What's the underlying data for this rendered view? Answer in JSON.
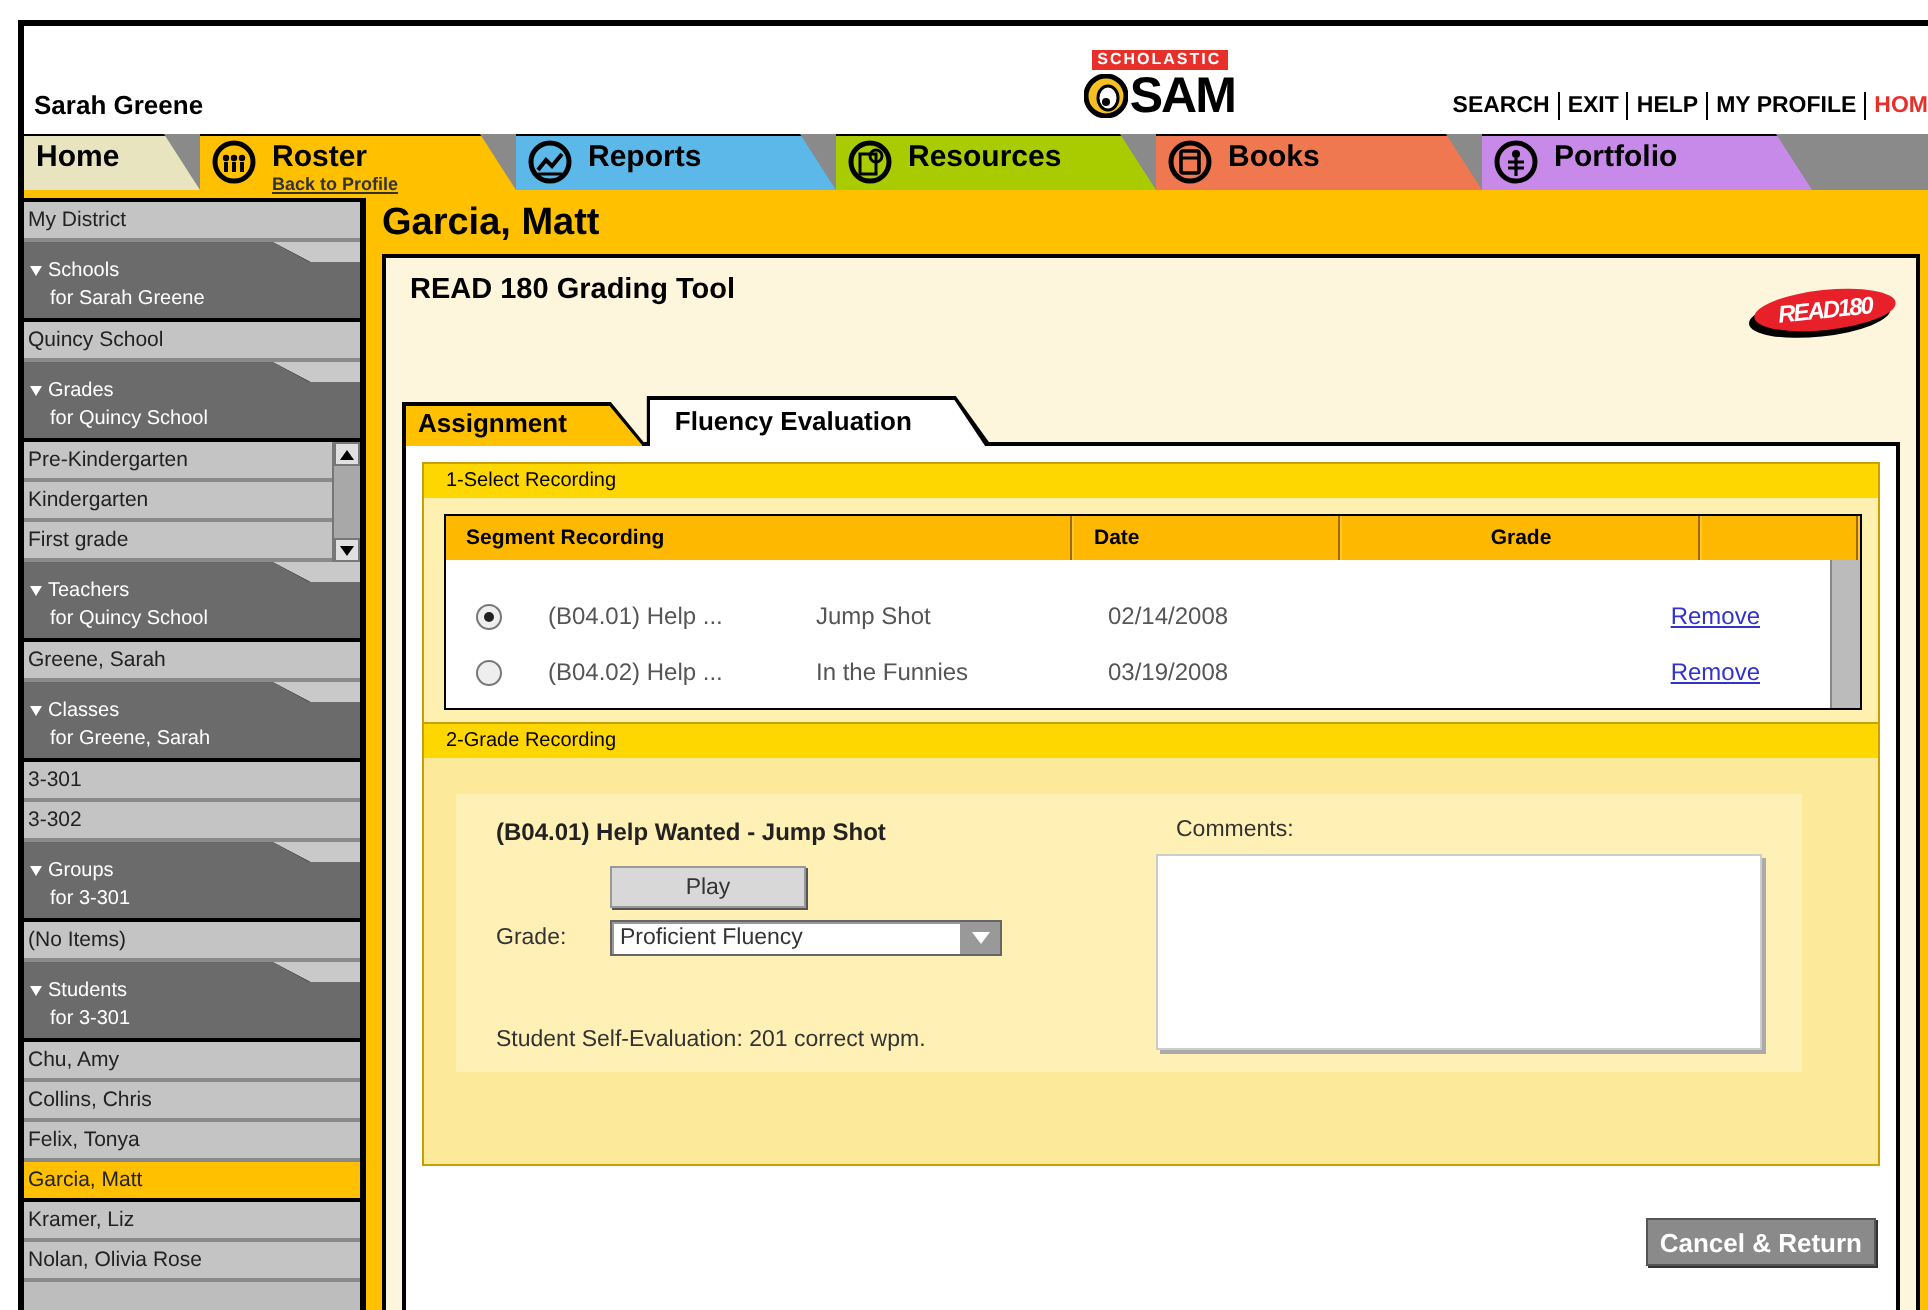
{
  "header": {
    "user_name": "Sarah Greene",
    "brand": "SCHOLASTIC",
    "logo": "SAM",
    "links": [
      {
        "label": "SEARCH",
        "kind": "plain"
      },
      {
        "label": "EXIT",
        "kind": "plain"
      },
      {
        "label": "HELP",
        "kind": "plain"
      },
      {
        "label": "MY PROFILE",
        "kind": "plain"
      },
      {
        "label": "HOM",
        "kind": "alert"
      }
    ]
  },
  "nav_tabs": [
    {
      "label": "Home",
      "selected": false,
      "color": "#e8e4c0"
    },
    {
      "label": "Roster",
      "sublink": "Back to Profile",
      "selected": true,
      "color": "#ffc000"
    },
    {
      "label": "Reports",
      "selected": false,
      "color": "#5bb8e8"
    },
    {
      "label": "Resources",
      "selected": false,
      "color": "#a8cc00"
    },
    {
      "label": "Books",
      "selected": false,
      "color": "#f07850"
    },
    {
      "label": "Portfolio",
      "selected": false,
      "color": "#c88ae8"
    }
  ],
  "sidebar": [
    {
      "kind": "link",
      "label": "My District",
      "selected": false
    },
    {
      "kind": "header",
      "title": "Schools",
      "subtitle": "for Sarah Greene"
    },
    {
      "kind": "link",
      "label": "Quincy School",
      "selected": false
    },
    {
      "kind": "header",
      "title": "Grades",
      "subtitle": "for Quincy School"
    },
    {
      "kind": "scroll_list",
      "items": [
        {
          "label": "Pre-Kindergarten",
          "selected": false
        },
        {
          "label": "Kindergarten",
          "selected": false
        },
        {
          "label": "First grade",
          "selected": false
        }
      ]
    },
    {
      "kind": "header",
      "title": "Teachers",
      "subtitle": "for Quincy School"
    },
    {
      "kind": "link",
      "label": "Greene, Sarah",
      "selected": false
    },
    {
      "kind": "header",
      "title": "Classes",
      "subtitle": "for Greene, Sarah"
    },
    {
      "kind": "link",
      "label": "3-301",
      "selected": false
    },
    {
      "kind": "link",
      "label": "3-302",
      "selected": false
    },
    {
      "kind": "header",
      "title": "Groups",
      "subtitle": "for 3-301"
    },
    {
      "kind": "link",
      "label": "(No Items)",
      "selected": false
    },
    {
      "kind": "header",
      "title": "Students",
      "subtitle": "for 3-301"
    },
    {
      "kind": "link",
      "label": "Chu, Amy",
      "selected": false
    },
    {
      "kind": "link",
      "label": "Collins, Chris",
      "selected": false
    },
    {
      "kind": "link",
      "label": "Felix, Tonya",
      "selected": false
    },
    {
      "kind": "link",
      "label": "Garcia, Matt",
      "selected": true
    },
    {
      "kind": "link",
      "label": "Kramer, Liz",
      "selected": false
    },
    {
      "kind": "link",
      "label": "Nolan, Olivia Rose",
      "selected": false
    }
  ],
  "main": {
    "student": "Garcia, Matt",
    "tool_title": "READ 180 Grading Tool",
    "product_logo": "READ180",
    "tabs": [
      {
        "label": "Assignment",
        "selected": false
      },
      {
        "label": "Fluency Evaluation",
        "selected": true
      }
    ],
    "select_section": {
      "title": "1-Select Recording",
      "columns": [
        "Segment Recording",
        "Date",
        "Grade"
      ],
      "rows": [
        {
          "selected": true,
          "segment": "(B04.01) Help ...",
          "title": "Jump Shot",
          "date": "02/14/2008",
          "action": "Remove"
        },
        {
          "selected": false,
          "segment": "(B04.02) Help ...",
          "title": "In the Funnies",
          "date": "03/19/2008",
          "action": "Remove"
        }
      ]
    },
    "grade_section": {
      "title": "2-Grade Recording",
      "recording": "(B04.01) Help Wanted - Jump Shot",
      "play": "Play",
      "grade_label": "Grade:",
      "grade_value": "Proficient Fluency",
      "self_evaluation": "Student Self-Evaluation: 201 correct wpm.",
      "comments_label": "Comments:"
    },
    "cancel": "Cancel & Return"
  }
}
